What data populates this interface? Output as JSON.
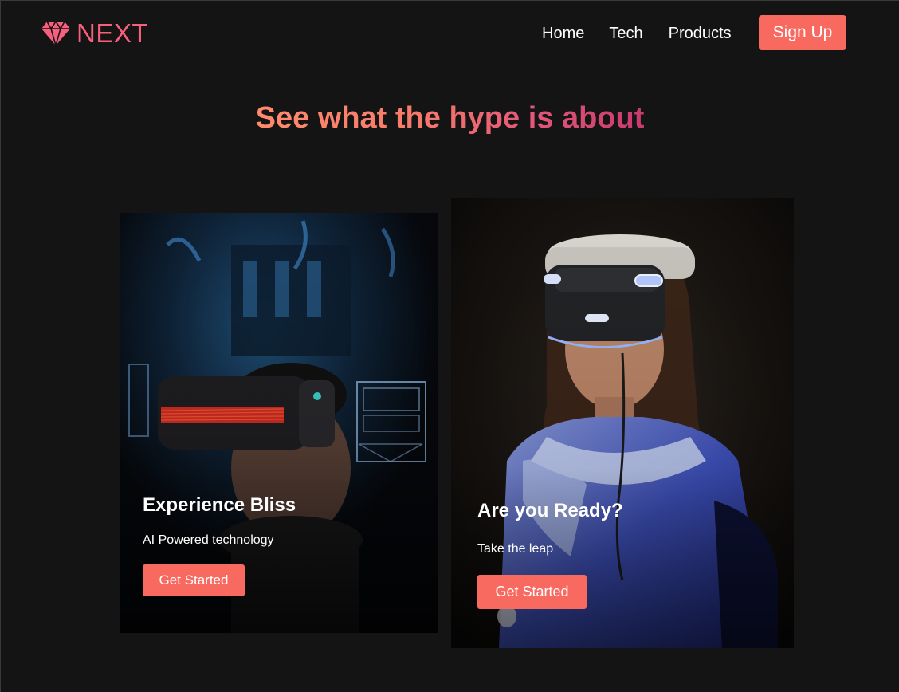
{
  "brand": {
    "name": "NEXT",
    "accent": "#f75f7c"
  },
  "nav": {
    "links": [
      {
        "label": "Home"
      },
      {
        "label": "Tech"
      },
      {
        "label": "Products"
      }
    ],
    "signup_label": "Sign Up",
    "button_color": "#f8695f"
  },
  "hero": {
    "headline": "See what the hype is about"
  },
  "cards": [
    {
      "title": "Experience Bliss",
      "subtitle": "AI Powered technology",
      "button_label": "Get Started"
    },
    {
      "title": "Are you Ready?",
      "subtitle": "Take the leap",
      "button_label": "Get Started"
    }
  ],
  "icons": {
    "logo": "diamond-icon"
  }
}
